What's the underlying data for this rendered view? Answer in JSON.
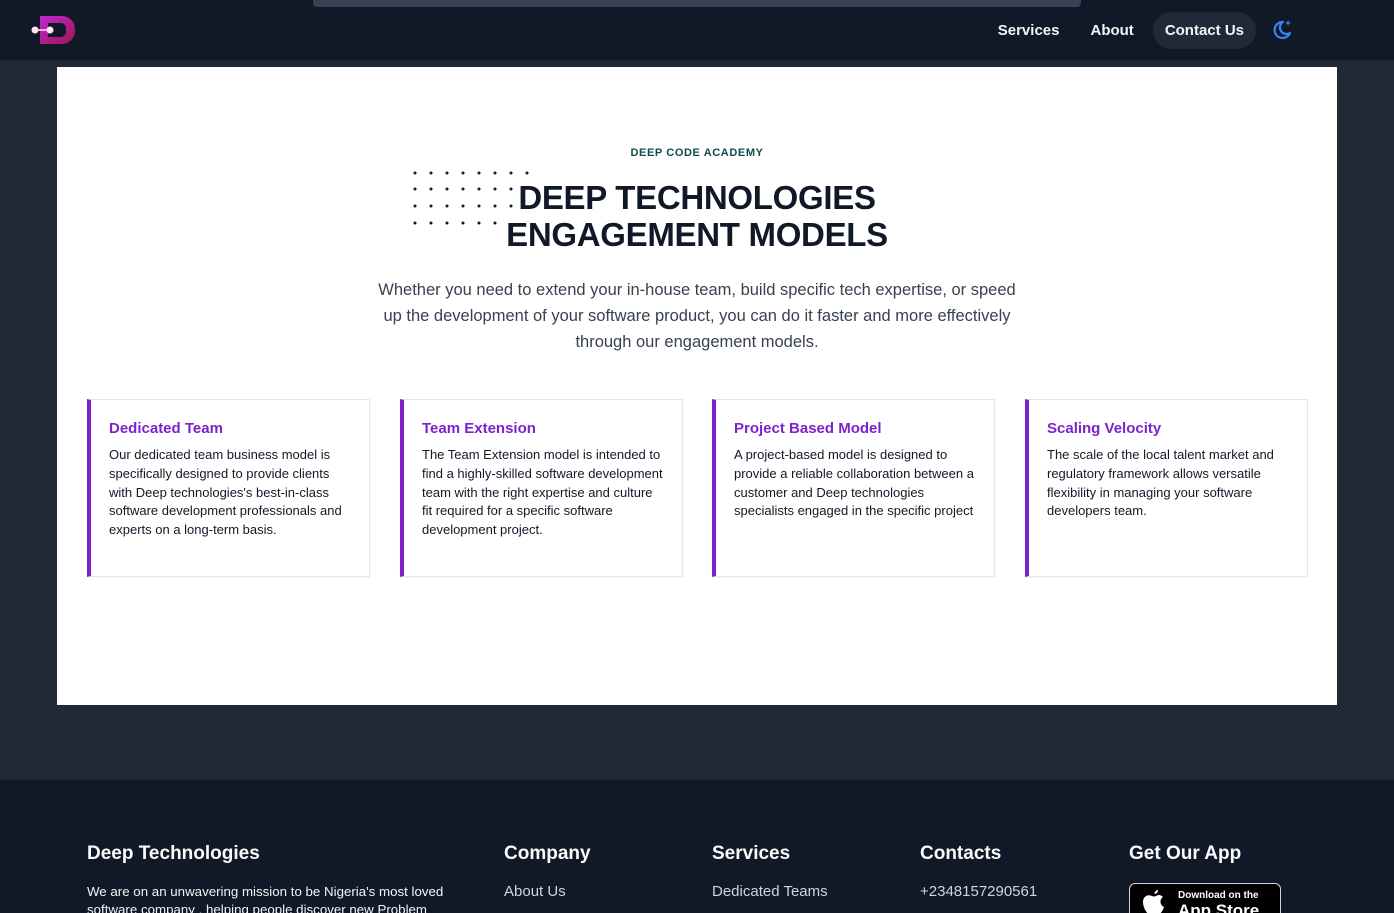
{
  "header": {
    "nav": [
      {
        "label": "Services",
        "active": false
      },
      {
        "label": "About",
        "active": false
      },
      {
        "label": "Contact Us",
        "active": true
      }
    ],
    "logo_icon": "deep-logo-icon",
    "theme_icon": "moon-star-icon"
  },
  "hero": {
    "eyebrow": "DEEP CODE ACADEMY",
    "title_line1": "DEEP TECHNOLOGIES",
    "title_line2": "ENGAGEMENT MODELS",
    "subtitle": "Whether you need to extend your in-house team, build specific tech expertise, or speed up the development of your software product, you can do it faster and more effectively through our engagement models."
  },
  "cards": [
    {
      "title": "Dedicated Team",
      "body": "Our dedicated team business model is specifically designed to provide clients with Deep technologies's best-in-class software development professionals and experts on a long-term basis."
    },
    {
      "title": "Team Extension",
      "body": "The Team Extension model is intended to find a highly-skilled software development team with the right expertise and culture fit required for a specific software development project."
    },
    {
      "title": "Project Based Model",
      "body": "A project-based model is designed to provide a reliable collaboration between a customer and Deep technologies specialists engaged in the specific project"
    },
    {
      "title": "Scaling Velocity",
      "body": "The scale of the local talent market and regulatory framework allows versatile flexibility in managing your software developers team."
    }
  ],
  "footer": {
    "brand": {
      "title": "Deep Technologies",
      "mission": "We are on an unwavering mission to be Nigeria's most loved software company , helping people discover new Problem"
    },
    "company": {
      "title": "Company",
      "item": "About Us"
    },
    "services": {
      "title": "Services",
      "item": "Dedicated Teams"
    },
    "contacts": {
      "title": "Contacts",
      "item": "+2348157290561"
    },
    "app": {
      "title": "Get Our App",
      "badge_small": "Download on the",
      "badge_big": "App Store"
    }
  },
  "colors": {
    "accent": "#7e22ce",
    "header_bg": "#111827",
    "page_bg": "#1f2937"
  }
}
